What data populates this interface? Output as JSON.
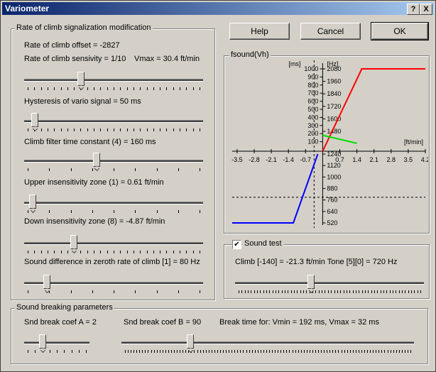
{
  "window": {
    "title": "Variometer",
    "help_icon": "?",
    "close_icon": "X"
  },
  "buttons": {
    "help": "Help",
    "cancel": "Cancel",
    "ok": "OK"
  },
  "group_roc": {
    "title": "Rate of climb signalization modification",
    "offset": "Rate of climb offset = -2827",
    "sensivity": "Rate of climb sensivity = 1/10",
    "vmax": "Vmax = 30.4 ft/min",
    "hysteresis": "Hysteresis of vario signal = 50 ms",
    "filter": "Climb filter time constant (4) = 160 ms",
    "upper": "Upper insensitivity zone (1) = 0.61 ft/min",
    "down": "Down insensitivity zone (8) = -4.87 ft/min",
    "sound_diff": "Sound difference in zeroth rate of climb [1] = 80 Hz"
  },
  "sliders": {
    "sensivity": 0.31,
    "hysteresis": 0.04,
    "filter": 0.4,
    "upper": 0.03,
    "down": 0.27,
    "sound_diff": 0.11,
    "sound_test": 0.4,
    "break_a": 0.25,
    "break_b": 0.23
  },
  "chart_panel": {
    "title": "fsound(Vh)"
  },
  "chart_data": {
    "type": "line",
    "title": "",
    "x_unit": "[ft/min]",
    "ms_unit": "[ms]",
    "hz_unit": "[Hz]",
    "x_ticks": [
      "-3.5",
      "-2.8",
      "-2.1",
      "-1.4",
      "-0.7",
      "0.7",
      "1.4",
      "2.1",
      "2.8",
      "3.5",
      "4.2"
    ],
    "xlim": [
      -3.7,
      4.2
    ],
    "ms_ticks": [
      "1000",
      "900",
      "800",
      "700",
      "600",
      "500",
      "400",
      "300",
      "200",
      "100"
    ],
    "hz_ticks_top": [
      "2080",
      "1960",
      "1840",
      "1720",
      "1600",
      "1480"
    ],
    "hz_ticks_bottom": [
      "1240",
      "1120",
      "1000",
      "880",
      "760",
      "640",
      "520"
    ],
    "series": [
      {
        "color": "#ff0000",
        "x": [
          0,
          1.6,
          4.2
        ],
        "y": [
          1240,
          2080,
          2080
        ]
      },
      {
        "color": "#00e000",
        "x": [
          0,
          1.4
        ],
        "y": [
          180,
          80
        ]
      },
      {
        "color": "#0000ff",
        "x": [
          -3.7,
          -1.2,
          -0.2
        ],
        "y": [
          520,
          520,
          1240
        ]
      }
    ]
  },
  "sound_test": {
    "label": "Sound test",
    "checked": "✔",
    "info": "Climb [-140] = -21.3 ft/min   Tone [5][0] = 720 Hz"
  },
  "group_break": {
    "title": "Sound breaking parameters",
    "coef_a": "Snd break coef A = 2",
    "coef_b": "Snd break coef B = 90",
    "break_time": "Break time for: Vmin = 192 ms, Vmax = 32 ms"
  }
}
